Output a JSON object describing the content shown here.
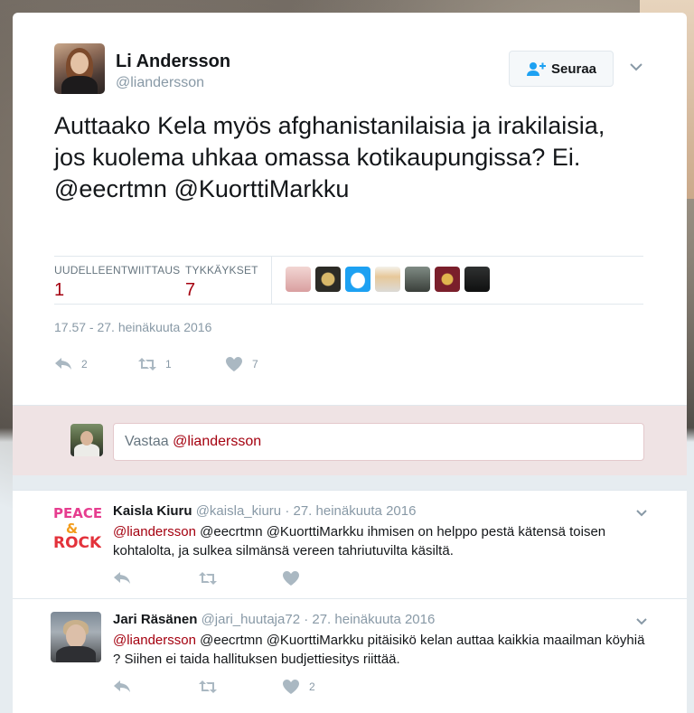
{
  "tweet": {
    "author_name": "Li Andersson",
    "author_handle": "@liandersson",
    "follow_label": "Seuraa",
    "text": "Auttaako Kela myös afghanistanilaisia ja irakilaisia, jos kuolema uhkaa omassa kotikaupungissa? Ei. @eecrtmn @KuorttiMarkku",
    "stats": {
      "retweets_label": "UUDELLEENTWIITTAUS",
      "retweets_value": "1",
      "likes_label": "TYKKÄYKSET",
      "likes_value": "7"
    },
    "timestamp": "17.57 - 27. heinäkuuta 2016",
    "actions": {
      "reply_count": "2",
      "retweet_count": "1",
      "like_count": "7"
    }
  },
  "reply_box": {
    "prefix": "Vastaa ",
    "mention": "@liandersson"
  },
  "replies": [
    {
      "name": "Kaisla Kiuru",
      "handle": "@kaisla_kiuru",
      "date": "27. heinäkuuta 2016",
      "mention": "@liandersson",
      "text": " @eecrtmn @KuorttiMarkku ihmisen on helppo pestä kätensä toisen kohtalolta, ja sulkea silmänsä vereen tahriutuvilta käsiltä.",
      "like_count": ""
    },
    {
      "name": "Jari Räsänen",
      "handle": "@jari_huutaja72",
      "date": "27. heinäkuuta 2016",
      "mention": "@liandersson",
      "text": " @eecrtmn @KuorttiMarkku pitäisikö kelan auttaa kaikkia maailman köyhiä ? Siihen ei taida hallituksen budjettiesitys riittää.",
      "like_count": "2"
    }
  ],
  "colors": {
    "accent": "#a4000f",
    "muted": "#8899a6",
    "icon": "#aab8c2"
  },
  "icons": {
    "follow": "add-user-icon",
    "chevron": "chevron-down-icon",
    "reply": "reply-icon",
    "retweet": "retweet-icon",
    "like": "heart-icon"
  }
}
